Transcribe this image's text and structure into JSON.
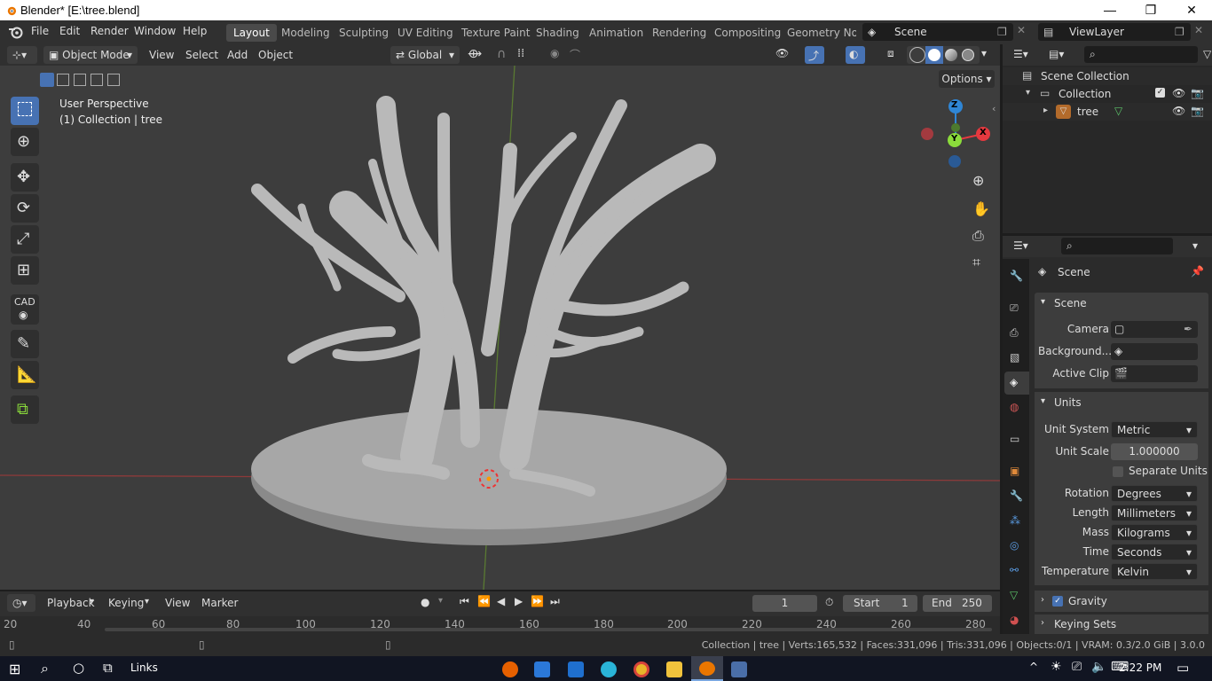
{
  "titlebar": {
    "title": "Blender* [E:\\tree.blend]",
    "minimize": "—",
    "maximize": "❐",
    "close": "✕"
  },
  "menus": [
    "File",
    "Edit",
    "Render",
    "Window",
    "Help"
  ],
  "workspaces": [
    "Layout",
    "Modeling",
    "Sculpting",
    "UV Editing",
    "Texture Paint",
    "Shading",
    "Animation",
    "Rendering",
    "Compositing",
    "Geometry Nod"
  ],
  "active_workspace": "Layout",
  "scene_field": "Scene",
  "viewlayer_field": "ViewLayer",
  "viewport_header": {
    "mode": "Object Mode",
    "menus": [
      "View",
      "Select",
      "Add",
      "Object"
    ],
    "orientation": "Global",
    "options": "Options"
  },
  "viewport": {
    "perspective": "User Perspective",
    "collection_info": "(1) Collection | tree",
    "gizmo": {
      "z": "Z",
      "y": "Y",
      "x": "X"
    },
    "tool_cad": "CAD"
  },
  "outliner": {
    "root": "Scene Collection",
    "collection": "Collection",
    "object": "tree"
  },
  "properties": {
    "header": "Scene",
    "scene_section": "Scene",
    "camera_label": "Camera",
    "background_label": "Background...",
    "active_clip_label": "Active Clip",
    "units_section": "Units",
    "unit_system_label": "Unit System",
    "unit_system": "Metric",
    "unit_scale_label": "Unit Scale",
    "unit_scale": "1.000000",
    "separate_units": "Separate Units",
    "rotation_label": "Rotation",
    "rotation": "Degrees",
    "length_label": "Length",
    "length": "Millimeters",
    "mass_label": "Mass",
    "mass": "Kilograms",
    "time_label": "Time",
    "time": "Seconds",
    "temperature_label": "Temperature",
    "temperature": "Kelvin",
    "gravity": "Gravity",
    "keying_sets": "Keying Sets"
  },
  "timeline": {
    "menus": [
      "Playback",
      "Keying",
      "View",
      "Marker"
    ],
    "current_frame": "1",
    "start_label": "Start",
    "start": "1",
    "end_label": "End",
    "end": "250",
    "ruler": [
      "20",
      "40",
      "60",
      "80",
      "100",
      "120",
      "140",
      "160",
      "180",
      "200",
      "220",
      "240",
      "260",
      "280"
    ]
  },
  "statusbar": {
    "stats": "Collection | tree | Verts:165,532 | Faces:331,096 | Tris:331,096 | Objects:0/1 | VRAM: 0.3/2.0 GiB | 3.0.0"
  },
  "taskbar": {
    "links": "Links",
    "time": "2:22 PM"
  },
  "colors": {
    "accent": "#4772b3",
    "x_axis": "#e4393f",
    "y_axis": "#8bdc3b",
    "z_axis": "#2f86d6"
  }
}
